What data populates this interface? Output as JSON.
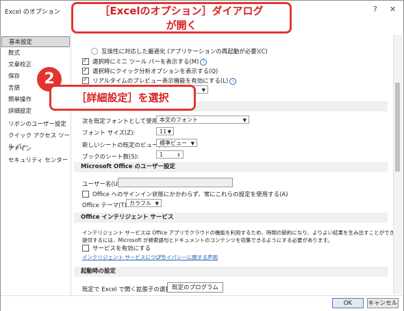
{
  "window": {
    "title": "Excel のオプション",
    "help": "?",
    "close": "✕"
  },
  "callouts": {
    "dialog": "［Excelのオプション］ダイアログ\nが開く",
    "step_number": "2",
    "step": "［詳細設定］を選択"
  },
  "sidebar": {
    "items": [
      {
        "label": "基本設定",
        "selected": true
      },
      {
        "label": "数式"
      },
      {
        "label": "文章校正"
      },
      {
        "label": "保存"
      },
      {
        "label": "言語"
      },
      {
        "label": "簡単操作"
      },
      {
        "label": "詳細設定"
      },
      {
        "label": "リボンのユーザー設定"
      },
      {
        "label": "クイック アクセス ツール バー"
      },
      {
        "label": "アドイン"
      },
      {
        "label": "セキュリティ センター"
      }
    ]
  },
  "ui_options": {
    "compat_radio": "互換性に対応した最適化 (アプリケーションの再起動が必要)(C)",
    "mini_toolbar": "選択時にミニ ツール バーを表示する(M)",
    "quick_analysis": "選択時にクイック分析オプションを表示する(Q)",
    "live_preview": "リアルタイムのプレビュー表示機能を有効にする(L)"
  },
  "new_workbook": {
    "font_label": "次を既定フォントとして使用(N):",
    "font_value": "本文のフォント",
    "size_label": "フォント サイズ(Z):",
    "size_value": "11",
    "view_label": "新しいシートの既定のビュー(V):",
    "view_value": "標準ビュー",
    "sheets_label": "ブックのシート数(S):",
    "sheets_value": "1"
  },
  "office_user": {
    "section": "Microsoft Office のユーザー設定",
    "username_label": "ユーザー名(U):",
    "always_use": "Office へのサインイン状態にかかわらず、常にこれらの設定を使用する(A)",
    "theme_label": "Office テーマ(T):",
    "theme_value": "カラフル"
  },
  "intelligent": {
    "section": "Office インテリジェント サービス",
    "description_1": "インテリジェント サービスは Office アプリでクラウドの機能を利用するため、時間の節約になり、よりよい結果を生み出すことができます。これらのサービスを",
    "description_2": "提供するには、Microsoft が検索語句とドキュメントのコンテンツを収集できるようにする必要があります。",
    "enable": "サービスを有効にする",
    "link_about": "インテリジェント サービスについて",
    "link_privacy": "プライバシーに関する声明"
  },
  "startup": {
    "section": "起動時の設定",
    "default_prog_label": "既定で Excel で開く拡張子の選択:",
    "default_prog_button": "既定のプログラム(D)..."
  },
  "footer": {
    "ok": "OK",
    "cancel": "キャンセル"
  }
}
